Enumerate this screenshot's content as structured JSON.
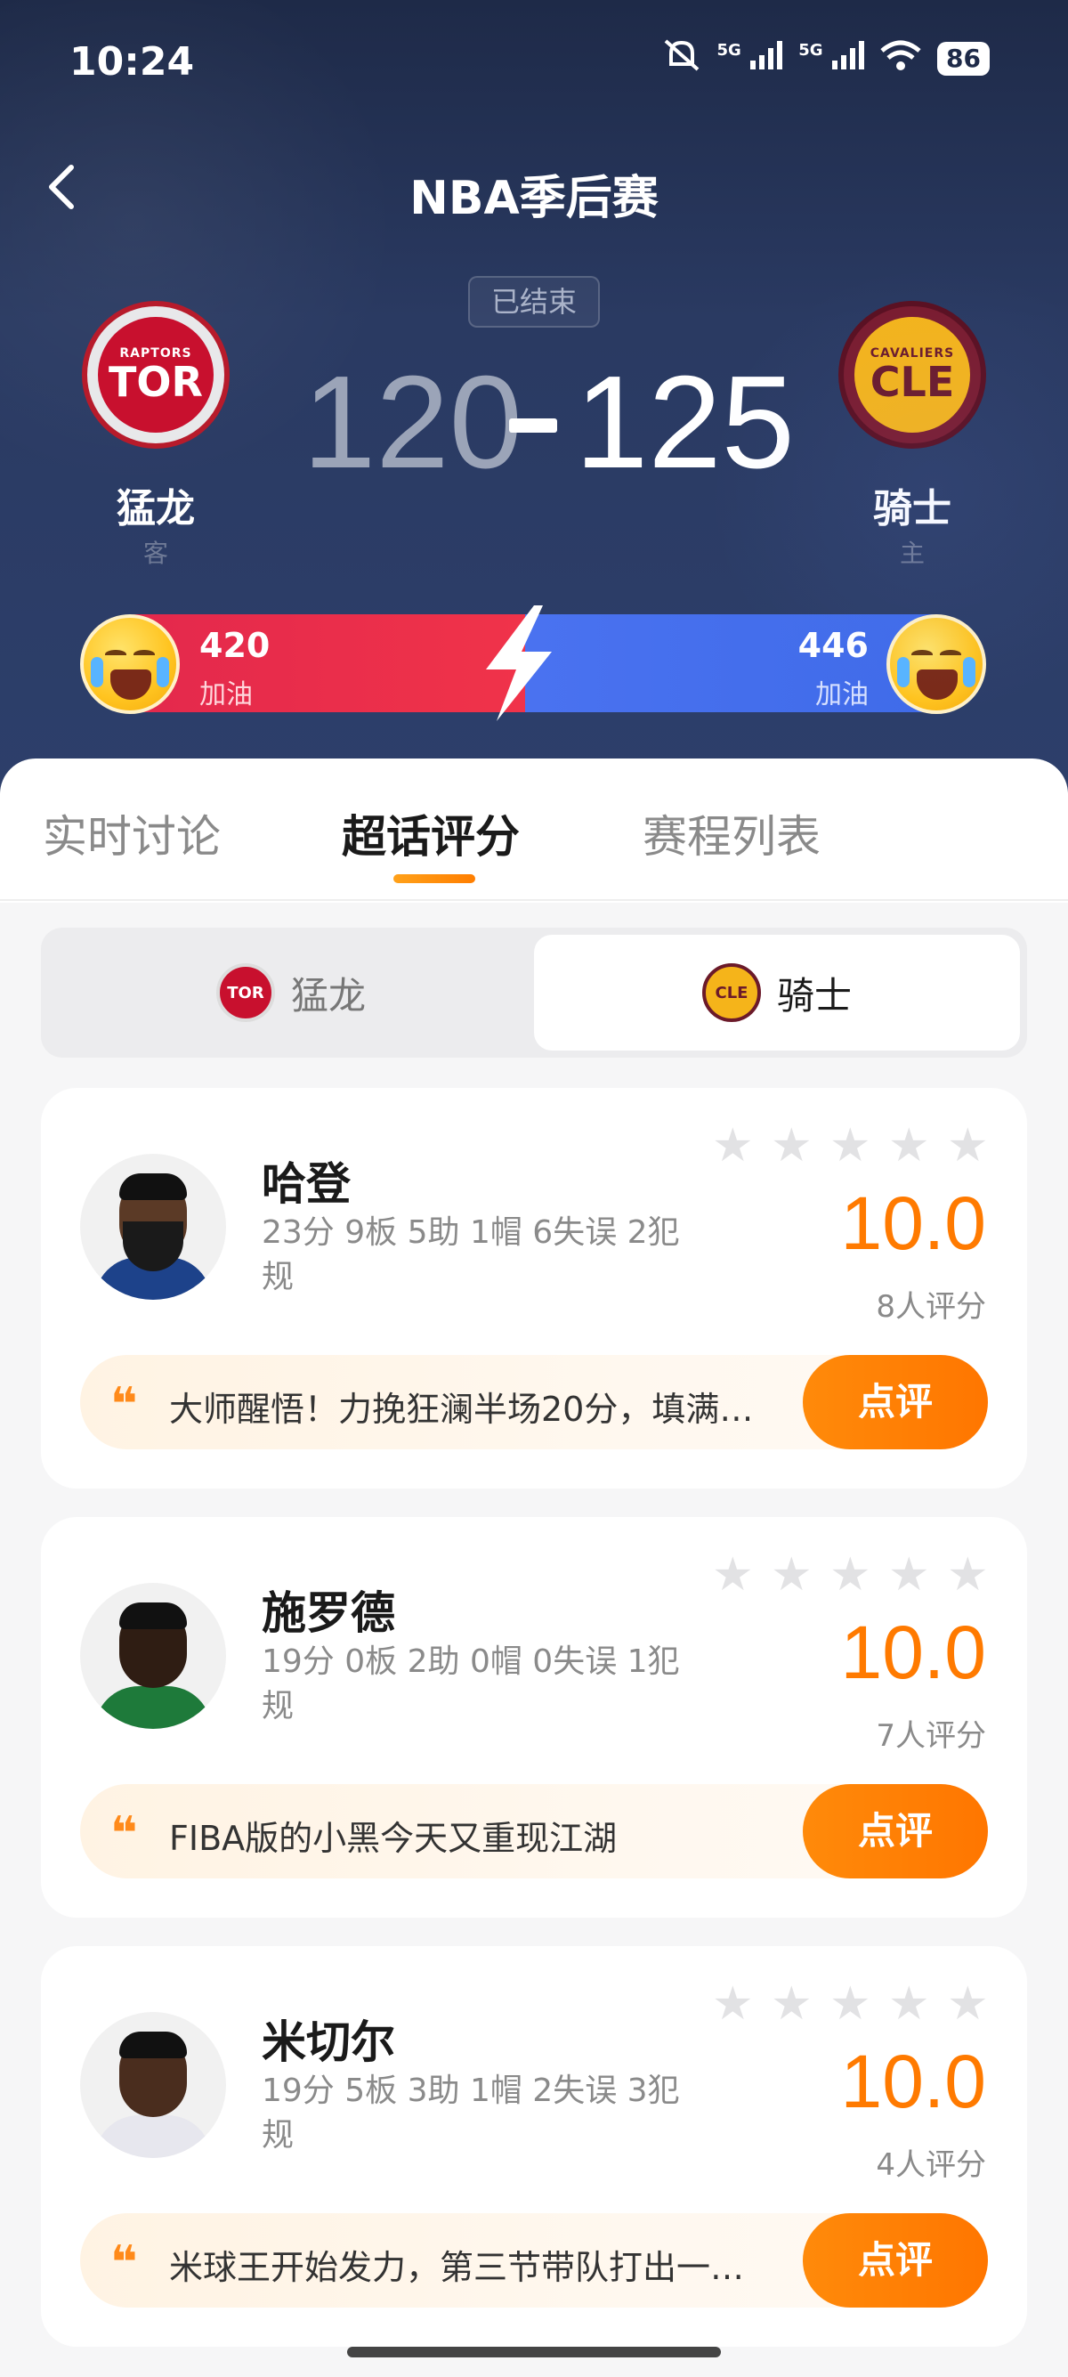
{
  "status_bar": {
    "time": "10:24",
    "network1": "5G",
    "network2": "5G",
    "battery": "86"
  },
  "nav": {
    "title": "NBA季后赛"
  },
  "game": {
    "status": "已结束",
    "away": {
      "name": "猛龙",
      "role": "客",
      "score": "120",
      "logo_top": "RAPTORS",
      "logo_abbr": "TOR"
    },
    "home": {
      "name": "骑士",
      "role": "主",
      "score": "125",
      "logo_top": "CAVALIERS",
      "logo_abbr": "CLE"
    },
    "score_separator": "-"
  },
  "cheer": {
    "away": {
      "count": "420",
      "label": "加油"
    },
    "home": {
      "count": "446",
      "label": "加油"
    }
  },
  "tabs": [
    {
      "label": "实时讨论"
    },
    {
      "label": "超话评分"
    },
    {
      "label": "赛程列表"
    }
  ],
  "team_switch": {
    "away": {
      "label": "猛龙",
      "abbr": "TOR"
    },
    "home": {
      "label": "骑士",
      "abbr": "CLE"
    }
  },
  "players": [
    {
      "name": "哈登",
      "stats": "23分 9板 5助 1帽 6失误 2犯规",
      "rating": "10.0",
      "rating_count": "8人评分",
      "comment": "大师醒悟！力挽狂澜半场20分，填满…",
      "button": "点评"
    },
    {
      "name": "施罗德",
      "stats": "19分 0板 2助 0帽 0失误 1犯规",
      "rating": "10.0",
      "rating_count": "7人评分",
      "comment": "FIBA版的小黑今天又重现江湖",
      "button": "点评"
    },
    {
      "name": "米切尔",
      "stats": "19分 5板 3助 1帽 2失误 3犯规",
      "rating": "10.0",
      "rating_count": "4人评分",
      "comment": "米球王开始发力，第三节带队打出一…",
      "button": "点评"
    }
  ],
  "quote_glyph": "❝",
  "colors": {
    "accent": "#ff7a00",
    "header_bg": "#1e2a48",
    "away_bar": "#e2274c",
    "home_bar": "#4a72f0"
  }
}
